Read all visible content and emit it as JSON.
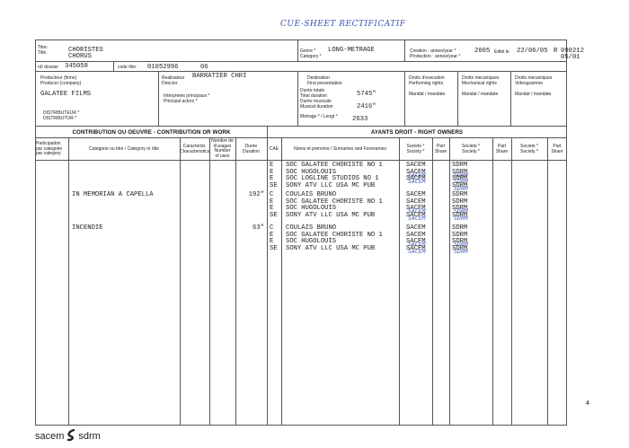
{
  "header_note": "CUE-SHEET  RECTIFICATIF",
  "page_number": "4",
  "brand": {
    "left": "sacem",
    "right": "sdrm"
  },
  "top": {
    "title_label": "Titre:\nTitle:",
    "title_fr": "CHORISTES",
    "title_en": "CHORUS",
    "genre_label": "Genre *\nCategory *",
    "genre": "LONG-METRAGE",
    "creation_label": "Creation : annee/year *\nProduction : annee/year *",
    "creation_year": "2005",
    "edit_label": "Edité le",
    "edit_date": "22/06/05",
    "edit_code": "R",
    "edit_ref": "090212",
    "edit_ref2": "05/01",
    "dossier_label": "n0 dossier",
    "dossier": "345058",
    "film_code_label": "code film :",
    "film_code": "01052996",
    "film_code_suffix": "06"
  },
  "info": {
    "producer_label": "Producteur (firme)\nProducer (company)",
    "producer": "GALATEE FILMS",
    "distributor_label": "DISTRIBUTEUR *\nDISTRIBUTOR *",
    "director_label": "Realisateur\nDirector",
    "director": "BARRATIER CHRI",
    "actors_label": "Interpretes principaux *\nPrincipal actors *",
    "destination_label": "Destination\nFirst presentation",
    "total_duration_label": "Durée totale\nTotal duration",
    "total_duration": "5745\"",
    "music_duration_label": "Durée musicale\nMusical duration",
    "music_duration": "2416\"",
    "footage_label": "Metrage * / Lengt *",
    "footage": "2633",
    "perf_rights_label": "Droits d'execution\nPerforming rights",
    "mech_rights_label": "Droits mecaniques\nMechanical rights",
    "mech_rights2_label": "Droits mecaniques\nVideogramme",
    "mandat": "Mandat / mandate"
  },
  "table": {
    "left_section": "CONTRIBUTION OU OEUVRE - CONTRIBUTION OR WORK",
    "right_section": "AYANTS DROIT - RIGHT OWNERS",
    "headers": {
      "participation": "Participation\npar categorie\npar category",
      "category": "Categorie ou titre / Category or title",
      "caract": "Caracterist.\nCharacteristics",
      "uses": "Nombre de\nd'usages\nNumber\nof uses",
      "duration": "Durée\nDuration",
      "cae": "CAE",
      "names": "Noms et prenoms / Surnames and Forenames",
      "society": "Societe *\nSociety *",
      "part": "Part\nShare"
    },
    "works": [
      {
        "title": "",
        "duration": "",
        "rows": [
          {
            "cae": "E",
            "name": "SOC GALATEE CHORISTE NO 1",
            "s1": "SACEM",
            "s2": "SDRM",
            "hand": false
          },
          {
            "cae": "E",
            "name": "SOC HUGOLOUIS",
            "s1": "SACEM",
            "s2": "SDRM",
            "hand": true
          },
          {
            "cae": "E",
            "name": "SOC LOGLINE STUDIOS  NO 1",
            "s1": "SACEM",
            "s2": "SDRM",
            "hand": true
          },
          {
            "cae": "SE",
            "name": "SONY ATV LLC USA MC PUB",
            "s1": "",
            "s2": "SDRM",
            "hand": true
          }
        ]
      },
      {
        "title": "IN MEMORIAN A CAPELLA",
        "duration": "192\"",
        "rows": [
          {
            "cae": "C",
            "name": "COULAIS BRUNO",
            "s1": "SACEM",
            "s2": "SDRM",
            "hand": false
          },
          {
            "cae": "E",
            "name": "SOC GALATEE CHORISTE NO 1",
            "s1": "SACEM",
            "s2": "SDRM",
            "hand": false
          },
          {
            "cae": "E",
            "name": "SOC HUGOLOUIS",
            "s1": "SACEM",
            "s2": "SDRM",
            "hand": true
          },
          {
            "cae": "SE",
            "name": "SONY ATV LLC USA MC PUB",
            "s1": "SACEM",
            "s2": "SDRM",
            "hand": true
          }
        ]
      },
      {
        "title": "INCENDIE",
        "duration": "63\"",
        "rows": [
          {
            "cae": "C",
            "name": "COULAIS BRUNO",
            "s1": "SACEM",
            "s2": "SDRM",
            "hand": false
          },
          {
            "cae": "E",
            "name": "SOC GALATEE CHORISTE NO 1",
            "s1": "SACEM",
            "s2": "SDRM",
            "hand": false
          },
          {
            "cae": "E",
            "name": "SOC HUGOLOUIS",
            "s1": "SACEM",
            "s2": "SDRM",
            "hand": true
          },
          {
            "cae": "SE",
            "name": "SONY ATV LLC USA MC PUB",
            "s1": "SACEM",
            "s2": "SDRM",
            "hand": true
          }
        ]
      }
    ]
  }
}
